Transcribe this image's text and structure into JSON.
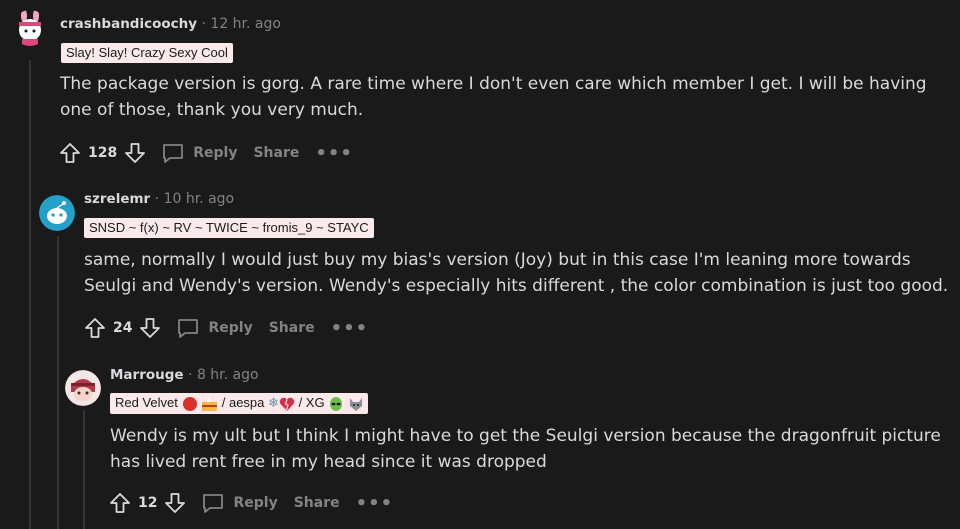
{
  "comments": [
    {
      "author": "crashbandicoochy",
      "time": "12 hr. ago",
      "flair": "Slay! Slay! Crazy Sexy Cool",
      "body": "The package version is gorg. A rare time where I don't even care which member I get. I will be having one of those, thank you very much.",
      "score": "128",
      "reply": "Reply",
      "share": "Share",
      "more": "•••"
    },
    {
      "author": "szrelemr",
      "time": "10 hr. ago",
      "flair": "SNSD ~ f(x) ~ RV ~ TWICE ~ fromis_9 ~ STAYC",
      "body": "same, normally I would just buy my bias's version (Joy) but in this case I'm leaning more towards Seulgi and Wendy's version. Wendy's especially hits different , the color combination is just too good.",
      "score": "24",
      "reply": "Reply",
      "share": "Share",
      "more": "•••"
    },
    {
      "author": "Marrouge",
      "time": "8 hr. ago",
      "flair_parts": [
        "Red Velvet",
        "/ aespa",
        "/ XG"
      ],
      "body": "Wendy is my ult but I think I might have to get the Seulgi version because the dragonfruit picture has lived rent free in my head since it was dropped",
      "score": "12",
      "reply": "Reply",
      "share": "Share",
      "more": "•••"
    }
  ],
  "separator": "·",
  "icons": [
    "upvote-icon",
    "downvote-icon",
    "comment-bubble-icon",
    "overflow-menu-icon"
  ]
}
